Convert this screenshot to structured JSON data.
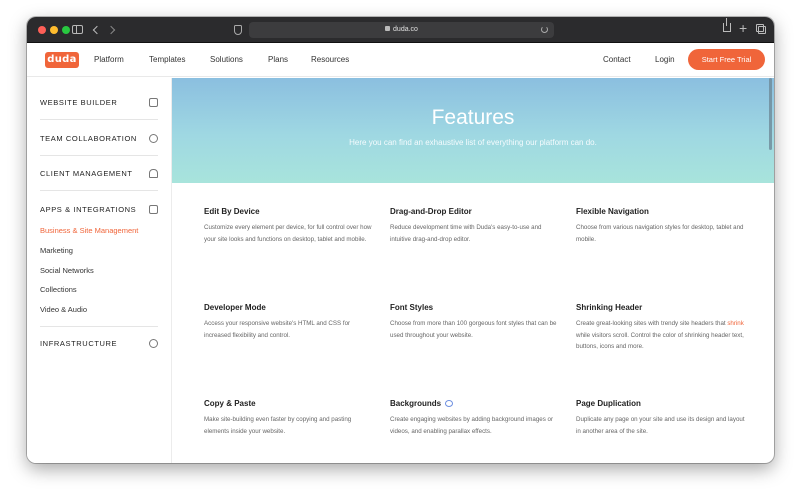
{
  "browser": {
    "url": "duda.co"
  },
  "nav": {
    "logo": "duda",
    "links": [
      "Platform",
      "Templates",
      "Solutions",
      "Plans",
      "Resources"
    ],
    "contact": "Contact",
    "login": "Login",
    "cta": "Start Free Trial"
  },
  "sidebar": {
    "sections": [
      {
        "label": "WEBSITE BUILDER",
        "icon": "builder-icon"
      },
      {
        "label": "TEAM COLLABORATION",
        "icon": "team-icon"
      },
      {
        "label": "CLIENT MANAGEMENT",
        "icon": "client-icon"
      },
      {
        "label": "APPS & INTEGRATIONS",
        "icon": "apps-icon"
      },
      {
        "label": "INFRASTRUCTURE",
        "icon": "infrastructure-icon"
      }
    ],
    "subitems": [
      "Business & Site Management",
      "Marketing",
      "Social Networks",
      "Collections",
      "Video & Audio"
    ],
    "active_subitem": "Business & Site Management"
  },
  "hero": {
    "title": "Features",
    "subtitle": "Here you can find an exhaustive list of everything our platform can do."
  },
  "features": [
    {
      "title": "Edit By Device",
      "desc": "Customize every element per device, for full control over how your site looks and functions on desktop, tablet and mobile."
    },
    {
      "title": "Drag-and-Drop Editor",
      "desc": "Reduce development time with Duda's easy-to-use and intuitive drag-and-drop editor."
    },
    {
      "title": "Flexible Navigation",
      "desc": "Choose from various navigation styles for desktop, tablet and mobile."
    },
    {
      "title": "Developer Mode",
      "desc": "Access your responsive website's HTML and CSS for increased flexibility and control."
    },
    {
      "title": "Font Styles",
      "desc": "Choose from more than 100 gorgeous font styles that can be used throughout your website."
    },
    {
      "title": "Shrinking Header",
      "desc_before": "Create great-looking sites with trendy site headers that ",
      "desc_highlight": "shrink",
      "desc_after": " while visitors scroll. Control the color of shrinking header text, buttons, icons and more."
    },
    {
      "title": "Copy & Paste",
      "desc": "Make site-building even faster by copying and pasting elements inside your website."
    },
    {
      "title": "Backgrounds",
      "desc": "Create engaging websites by adding background images or videos, and enabling parallax effects."
    },
    {
      "title": "Page Duplication",
      "desc": "Duplicate any page on your site and use its design and layout in another area of the site."
    }
  ],
  "colors": {
    "brand": "#f0653a",
    "hero_top": "#8bbfe0",
    "hero_bottom": "#a8e4dc"
  }
}
